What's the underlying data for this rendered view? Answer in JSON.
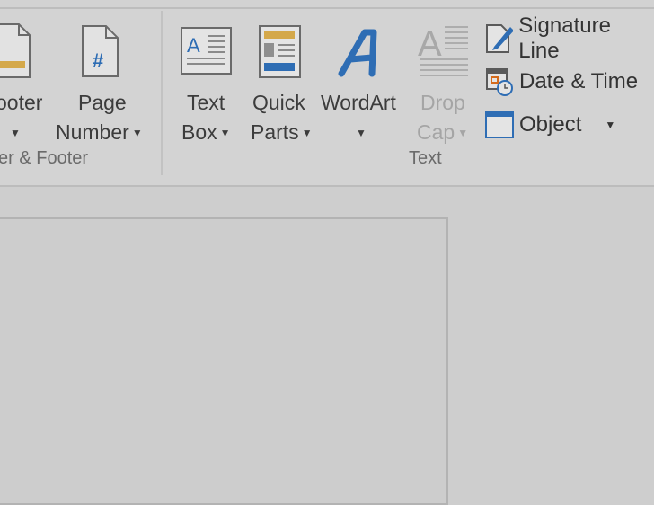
{
  "ribbon": {
    "header_footer": {
      "footer_label": "ooter",
      "page_number_line1": "Page",
      "page_number_line2": "Number",
      "group_label": "er & Footer"
    },
    "text": {
      "text_box_line1": "Text",
      "text_box_line2": "Box",
      "quick_parts_line1": "Quick",
      "quick_parts_line2": "Parts",
      "wordart": "WordArt",
      "drop_cap_line1": "Drop",
      "drop_cap_line2": "Cap",
      "signature_line": "Signature Line",
      "date_time": "Date & Time",
      "object": "Object",
      "group_label": "Text"
    }
  },
  "colors": {
    "accent_blue": "#2e6db4",
    "accent_gold": "#d4a84a"
  }
}
